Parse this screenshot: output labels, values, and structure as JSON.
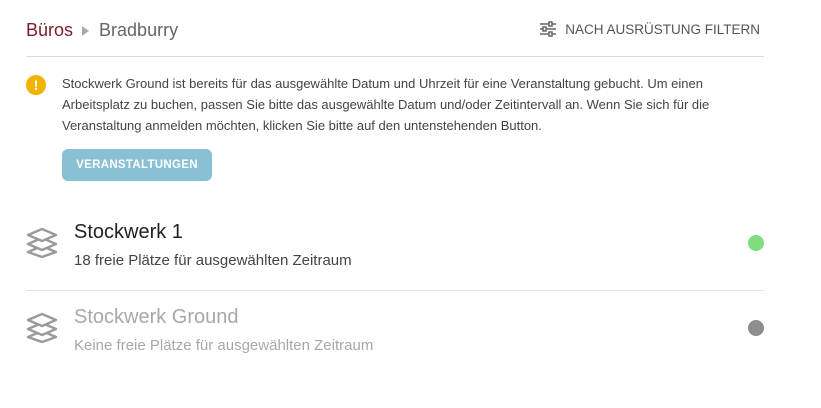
{
  "breadcrumb": {
    "root": "Büros",
    "current": "Bradburry"
  },
  "filter": {
    "label": "NACH AUSRÜSTUNG FILTERN",
    "icon": "sliders-icon"
  },
  "alert": {
    "icon": "exclamation-icon",
    "color": "#f2b400",
    "text": "Stockwerk Ground ist bereits für das ausgewählte Datum und Uhrzeit für eine Veranstaltung gebucht. Um einen Arbeitsplatz zu buchen, passen Sie bitte das ausgewählte Datum und/oder Zeitintervall an. Wenn Sie sich für die Veranstaltung anmelden möchten, klicken Sie bitte auf den untenstehenden Button."
  },
  "events_button": {
    "label": "VERANSTALTUNGEN",
    "color": "#8ac0d3"
  },
  "floors": [
    {
      "name": "Stockwerk 1",
      "availability": "18 freie Plätze für ausgewählten Zeitraum",
      "icon": "layers-icon",
      "status_color": "#7fdc7f"
    },
    {
      "name": "Stockwerk Ground",
      "availability": "Keine freie Plätze für ausgewählten Zeitraum",
      "icon": "layers-icon",
      "status_color": "#8e8e8e"
    }
  ]
}
